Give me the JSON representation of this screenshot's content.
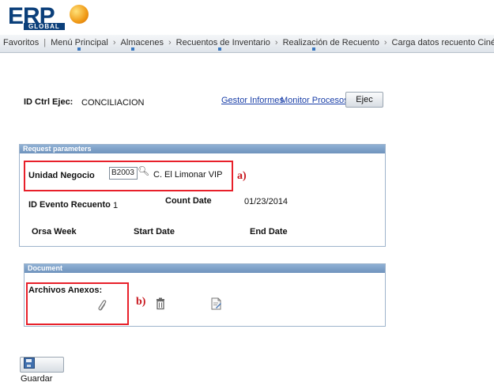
{
  "logo": {
    "name": "ERP",
    "sub": "GLOBAL"
  },
  "breadcrumb": [
    "Favoritos",
    "Menú Principal",
    "Almacenes",
    "Recuentos de Inventario",
    "Realización de Recuento",
    "Carga datos recuento Cinépolis"
  ],
  "run_control": {
    "label": "ID Ctrl Ejec:",
    "value": "CONCILIACION",
    "link_report_manager": "Gestor Informes",
    "link_process_monitor": "Monitor Procesos",
    "run_button": "Ejec"
  },
  "request_section": {
    "header": "Request parameters",
    "unidad_label": "Unidad Negocio",
    "unidad_value": "B2003",
    "unidad_desc": "C. El Limonar VIP",
    "evento_label": "ID Evento Recuento",
    "evento_value": "1",
    "count_date_label": "Count Date",
    "count_date_value": "01/23/2014",
    "orsa_week_label": "Orsa Week",
    "start_date_label": "Start Date",
    "end_date_label": "End Date"
  },
  "document_section": {
    "header": "Document",
    "attachments_label": "Archivos Anexos:"
  },
  "annotations": {
    "a": "a)",
    "b": "b)"
  },
  "save_button": "Guardar",
  "colors": {
    "highlight": "#e8202a",
    "section_header": "#7fa1c8",
    "link": "#1a3fa8"
  }
}
